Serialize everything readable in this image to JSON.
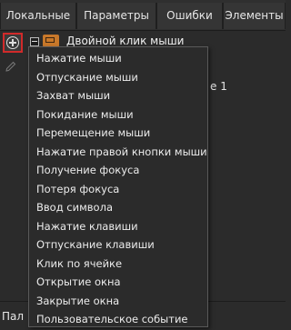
{
  "tabs": [
    "Локальные",
    "Параметры",
    "Ошибки",
    "Элементы"
  ],
  "tree": {
    "label": "Двойной клик мыши",
    "trailing_text": "е 1"
  },
  "bottom_tab": "Пал",
  "menu": {
    "items": [
      "Нажатие мыши",
      "Отпускание мыши",
      "Захват мыши",
      "Покидание мыши",
      "Перемещение мыши",
      "Нажатие правой кнопки мыши",
      "Получение фокуса",
      "Потеря фокуса",
      "Ввод символа",
      "Нажатие клавиши",
      "Отпускание клавиши",
      "Клик по ячейке",
      "Открытие окна",
      "Закрытие окна",
      "Пользовательское событие"
    ]
  },
  "colors": {
    "highlight_border": "#d12a2a",
    "event_icon": "#c8782a",
    "background": "#2b2b2b"
  }
}
